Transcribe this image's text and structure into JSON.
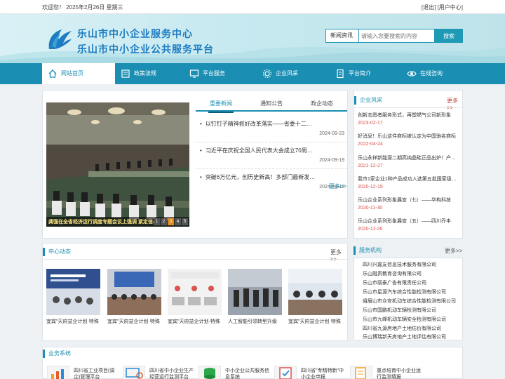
{
  "topbar": {
    "welcome": "欢迎您！ 2025年2月26日 星期三",
    "links": "[退出] [用户中心]"
  },
  "header": {
    "brand_line1": "乐山市中小企业服务中心",
    "brand_line2": "乐山市中小企业公共服务平台",
    "search": {
      "category": "新闻资讯",
      "placeholder": "请输入您要搜索的内容",
      "button": "搜索"
    }
  },
  "nav": {
    "items": [
      {
        "label": "网站首页",
        "icon": "home-icon"
      },
      {
        "label": "政策法规",
        "icon": "book-icon"
      },
      {
        "label": "平台服务",
        "icon": "monitor-icon"
      },
      {
        "label": "企业风采",
        "icon": "gear-icon"
      },
      {
        "label": "平台简介",
        "icon": "document-icon"
      },
      {
        "label": "在线咨询",
        "icon": "eye-icon"
      }
    ]
  },
  "news": {
    "slide_caption": "龚强在全省经济运行调度专题会议上强调 紧定信心",
    "slide_pages": [
      "1",
      "2",
      "3",
      "4",
      "5"
    ],
    "tabs": [
      "重要新闻",
      "通知公告",
      "政企动态"
    ],
    "items": [
      {
        "title": "以钉钉子精神抓好改革落实——省委十二…",
        "date": "2024-09-23"
      },
      {
        "title": "习近平在庆祝全国人民代表大会成立70周…",
        "date": "2024-09-19"
      },
      {
        "title": "突破6万亿元，创历史新高！多部门最新发…",
        "date": "2024-09-13"
      }
    ],
    "more": "更多>>"
  },
  "company": {
    "title": "企业风采",
    "more": "更多>>",
    "items": [
      {
        "title": "创新志愿者服务形式，再塑燃气公司新形象",
        "date": "2023-02-17"
      },
      {
        "title": "好消息！乐山这件商标被认定为中国驰名商标",
        "date": "2022-04-24"
      },
      {
        "title": "乐山永祥新能源二期高纯晶硅正品出炉！产…",
        "date": "2021-12-27"
      },
      {
        "title": "我市1家企业1种产品成功入选第五批国家级…",
        "date": "2020-12-15"
      },
      {
        "title": "乐山企业系列形象展宣（七）——华构科技",
        "date": "2020-11-30"
      },
      {
        "title": "乐山企业系列形象展宣（五）——四川乔丰",
        "date": "2020-11-26"
      }
    ]
  },
  "center": {
    "title": "中心动态",
    "more": "更多>>",
    "thumbs": [
      {
        "caption": "宜宾\"天府益企计划·特殊"
      },
      {
        "caption": "宜宾\"天府益企计划·特殊"
      },
      {
        "caption": "宜宾\"天府益企计划·特殊"
      },
      {
        "caption": "人工智能引领转型升级"
      },
      {
        "caption": "宜宾\"天府益企计划·特殊"
      }
    ]
  },
  "orgs": {
    "title": "服务机构",
    "more": "更多>>",
    "items": [
      "四川兴嘉友信息技术服务有限公司",
      "乐山融贯教育咨询有限公司",
      "乐山市丽泰广告有限责任公司",
      "乐山市星源汽车综合性能检测有限公司",
      "峨眉山市众安机动车综合性能检测有限公司",
      "乐山市国鹏机动车辆检测有限公司",
      "乐山市九峰机动车辆安全检测有限公司",
      "四川省九源房地产土地估价有限公司",
      "乐山博瑞新天房地产土地评估有限公司"
    ]
  },
  "biz": {
    "title": "业务系统",
    "items": [
      "四川省工业项目(调企)管理平台",
      "四川省中小企业生产经营运行监测平台",
      "中小企业公共服务信息系统",
      "四川省\"专精特新\"中小企业申报",
      "重点培育中小企业运行监测填报"
    ]
  }
}
